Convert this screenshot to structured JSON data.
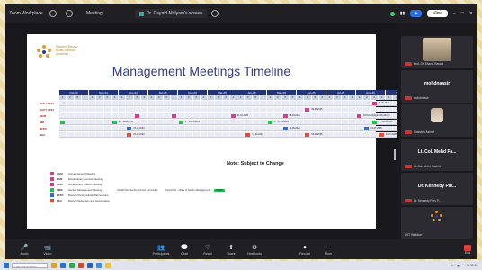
{
  "app": {
    "brand": "Zoom Workplace",
    "meeting_label": "Meeting",
    "share_label": "Dr. Dayaid Malyam's screen",
    "top_right_pill": "View"
  },
  "slide": {
    "org_lines": [
      "Shaheed Benazir",
      "Bhutto Medical",
      "University"
    ],
    "title": "Management Meetings Timeline",
    "months": [
      "Oct-24",
      "Nov-24",
      "Dec-24",
      "Jan-25",
      "Feb-25",
      "Mar-25",
      "Apr-25",
      "May-25",
      "Jun-25",
      "Jul-25",
      "Aug-25",
      "Sep-25"
    ],
    "week_numbers": [
      "1",
      "2",
      "3",
      "4"
    ],
    "rows": [
      {
        "label": "ACPY 2024",
        "markers": [
          {
            "color": "#d93c8a",
            "week": 42,
            "text": "07-04-2025"
          }
        ]
      },
      {
        "label": "ACPY 2024",
        "markers": [
          {
            "color": "#d93c8a",
            "week": 33,
            "text": "09-06-2025"
          }
        ]
      },
      {
        "label": "MCM",
        "markers": [
          {
            "color": "#d93c8a",
            "week": 10,
            "text": ""
          },
          {
            "color": "#d93c8a",
            "week": 15,
            "text": ""
          },
          {
            "color": "#d93c8a",
            "week": 23,
            "text": "21-01-2025"
          },
          {
            "color": "#d93c8a",
            "week": 30,
            "text": "08-04-2025"
          },
          {
            "color": "#d93c8a",
            "week": 40,
            "text": "18-5-2024(Grand Pre-Boar)"
          }
        ]
      },
      {
        "label": "MM",
        "markers": [
          {
            "color": "#23c34a",
            "week": 0,
            "text": ""
          },
          {
            "color": "#23c34a",
            "week": 7,
            "text": "D.T. 2024(LUS)"
          },
          {
            "color": "#23c34a",
            "week": 16,
            "text": "8** 15-11-2024"
          },
          {
            "color": "#23c34a",
            "week": 28,
            "text": "8** 17-03-2025"
          },
          {
            "color": "#23c34a",
            "week": 42,
            "text": "4** 30-06-2025"
          }
        ]
      },
      {
        "label": "BFPC",
        "markers": [
          {
            "color": "#2a6fd6",
            "week": 9,
            "text": "07-10-2024"
          },
          {
            "color": "#2a6fd6",
            "week": 30,
            "text": "12-05-2025"
          },
          {
            "color": "#2a6fd6",
            "week": 41,
            "text": "01-07-2025"
          }
        ]
      },
      {
        "label": "BEA",
        "markers": [
          {
            "color": "#e64a3b",
            "week": 9,
            "text": "22-10-2024"
          },
          {
            "color": "#e64a3b",
            "week": 25,
            "text": "17-12-2024"
          },
          {
            "color": "#e64a3b",
            "week": 33,
            "text": "18-04-2025"
          },
          {
            "color": "#e64a3b",
            "week": 43,
            "text": "24-07-2025"
          }
        ]
      }
    ],
    "note": "Note: Subject to Change",
    "legend": [
      {
        "code": "AGM",
        "text": "Annual General Meeting",
        "color": "#d93c8a"
      },
      {
        "code": "EGM",
        "text": "Extraordinary General Meeting",
        "color": "#d93c8a"
      },
      {
        "code": "MCM",
        "text": "Management Council Meeting",
        "color": "#d93c8a"
      },
      {
        "code": "SMM",
        "text": "Section Management Meeting",
        "color": "#23c34a"
      },
      {
        "code": "BFPC",
        "text": "Board of Postgraduate Partnerships",
        "color": "#2a6fd6"
      },
      {
        "code": "BEA",
        "text": "Board of Education and Accreditation",
        "color": "#e64a3b"
      }
    ],
    "legend_extra_1": "OHS/IOSH- Section Control Committee",
    "legend_extra_2": "Dept/OSS - Office of Section Management",
    "legend_extra_badge": "TODAY"
  },
  "participants": [
    {
      "name": "Prof. Dr. Shazia Rasool",
      "type": "photo"
    },
    {
      "name": "mohdnaasir",
      "type": "name",
      "sub": "mohdnaasir"
    },
    {
      "name": "Shaheen Ashraf",
      "type": "round"
    },
    {
      "name": "Lt. Col. Mehd Fa...",
      "type": "name",
      "sub": "Lt. Col. Mehd Rashid"
    },
    {
      "name": "Dr. Kennedy Pai...",
      "type": "name",
      "sub": "Dr. Kennedy Pary P..."
    },
    {
      "name": "DST Webinar",
      "type": "logo"
    }
  ],
  "controls": [
    {
      "label": "Audio",
      "glyph": "🎤",
      "red": true
    },
    {
      "label": "Video",
      "glyph": "📹",
      "red": true
    },
    {
      "label": "Participants",
      "glyph": "👥",
      "red": false
    },
    {
      "label": "Chat",
      "glyph": "💬",
      "red": false
    },
    {
      "label": "React",
      "glyph": "♡",
      "red": false
    },
    {
      "label": "Share",
      "glyph": "⬆",
      "red": false
    },
    {
      "label": "Host tools",
      "glyph": "⚙",
      "red": false
    },
    {
      "label": "Record",
      "glyph": "⏺",
      "red": false
    },
    {
      "label": "More",
      "glyph": "⋯",
      "red": false
    }
  ],
  "end_label": "End",
  "taskbar": {
    "search_placeholder": "Type here to search",
    "time": "10:26 AM"
  }
}
